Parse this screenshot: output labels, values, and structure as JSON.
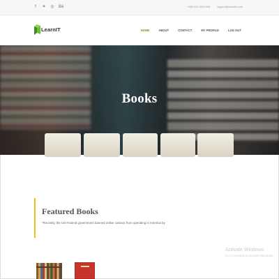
{
  "topbar": {
    "social": [
      {
        "icon": "facebook-icon",
        "glyph": "f"
      },
      {
        "icon": "twitter-icon",
        "glyph": "✦"
      },
      {
        "icon": "instagram-icon",
        "glyph": "◎"
      },
      {
        "icon": "behance-icon",
        "glyph": "Bė"
      }
    ],
    "phone": "+880 012 3654 896",
    "email": "support@colorlib.com"
  },
  "header": {
    "brand": "LearnIT",
    "nav": [
      {
        "label": "HOME",
        "active": true
      },
      {
        "label": "ABOUT",
        "active": false
      },
      {
        "label": "CONTACT",
        "active": false
      },
      {
        "label": "MY PROFILE",
        "active": false
      },
      {
        "label": "LOG OUT",
        "active": false
      }
    ]
  },
  "hero": {
    "title": "Books"
  },
  "featured": {
    "heading": "Featured Books",
    "text": "\"Recently, the US Federal government banned online casinos from operating in America by"
  },
  "watermark": {
    "line1": "Activate Windows",
    "line2": "Go to Settings to activate Windows."
  },
  "colors": {
    "accent": "#5aa12f",
    "featured_border": "#e8c21a"
  }
}
